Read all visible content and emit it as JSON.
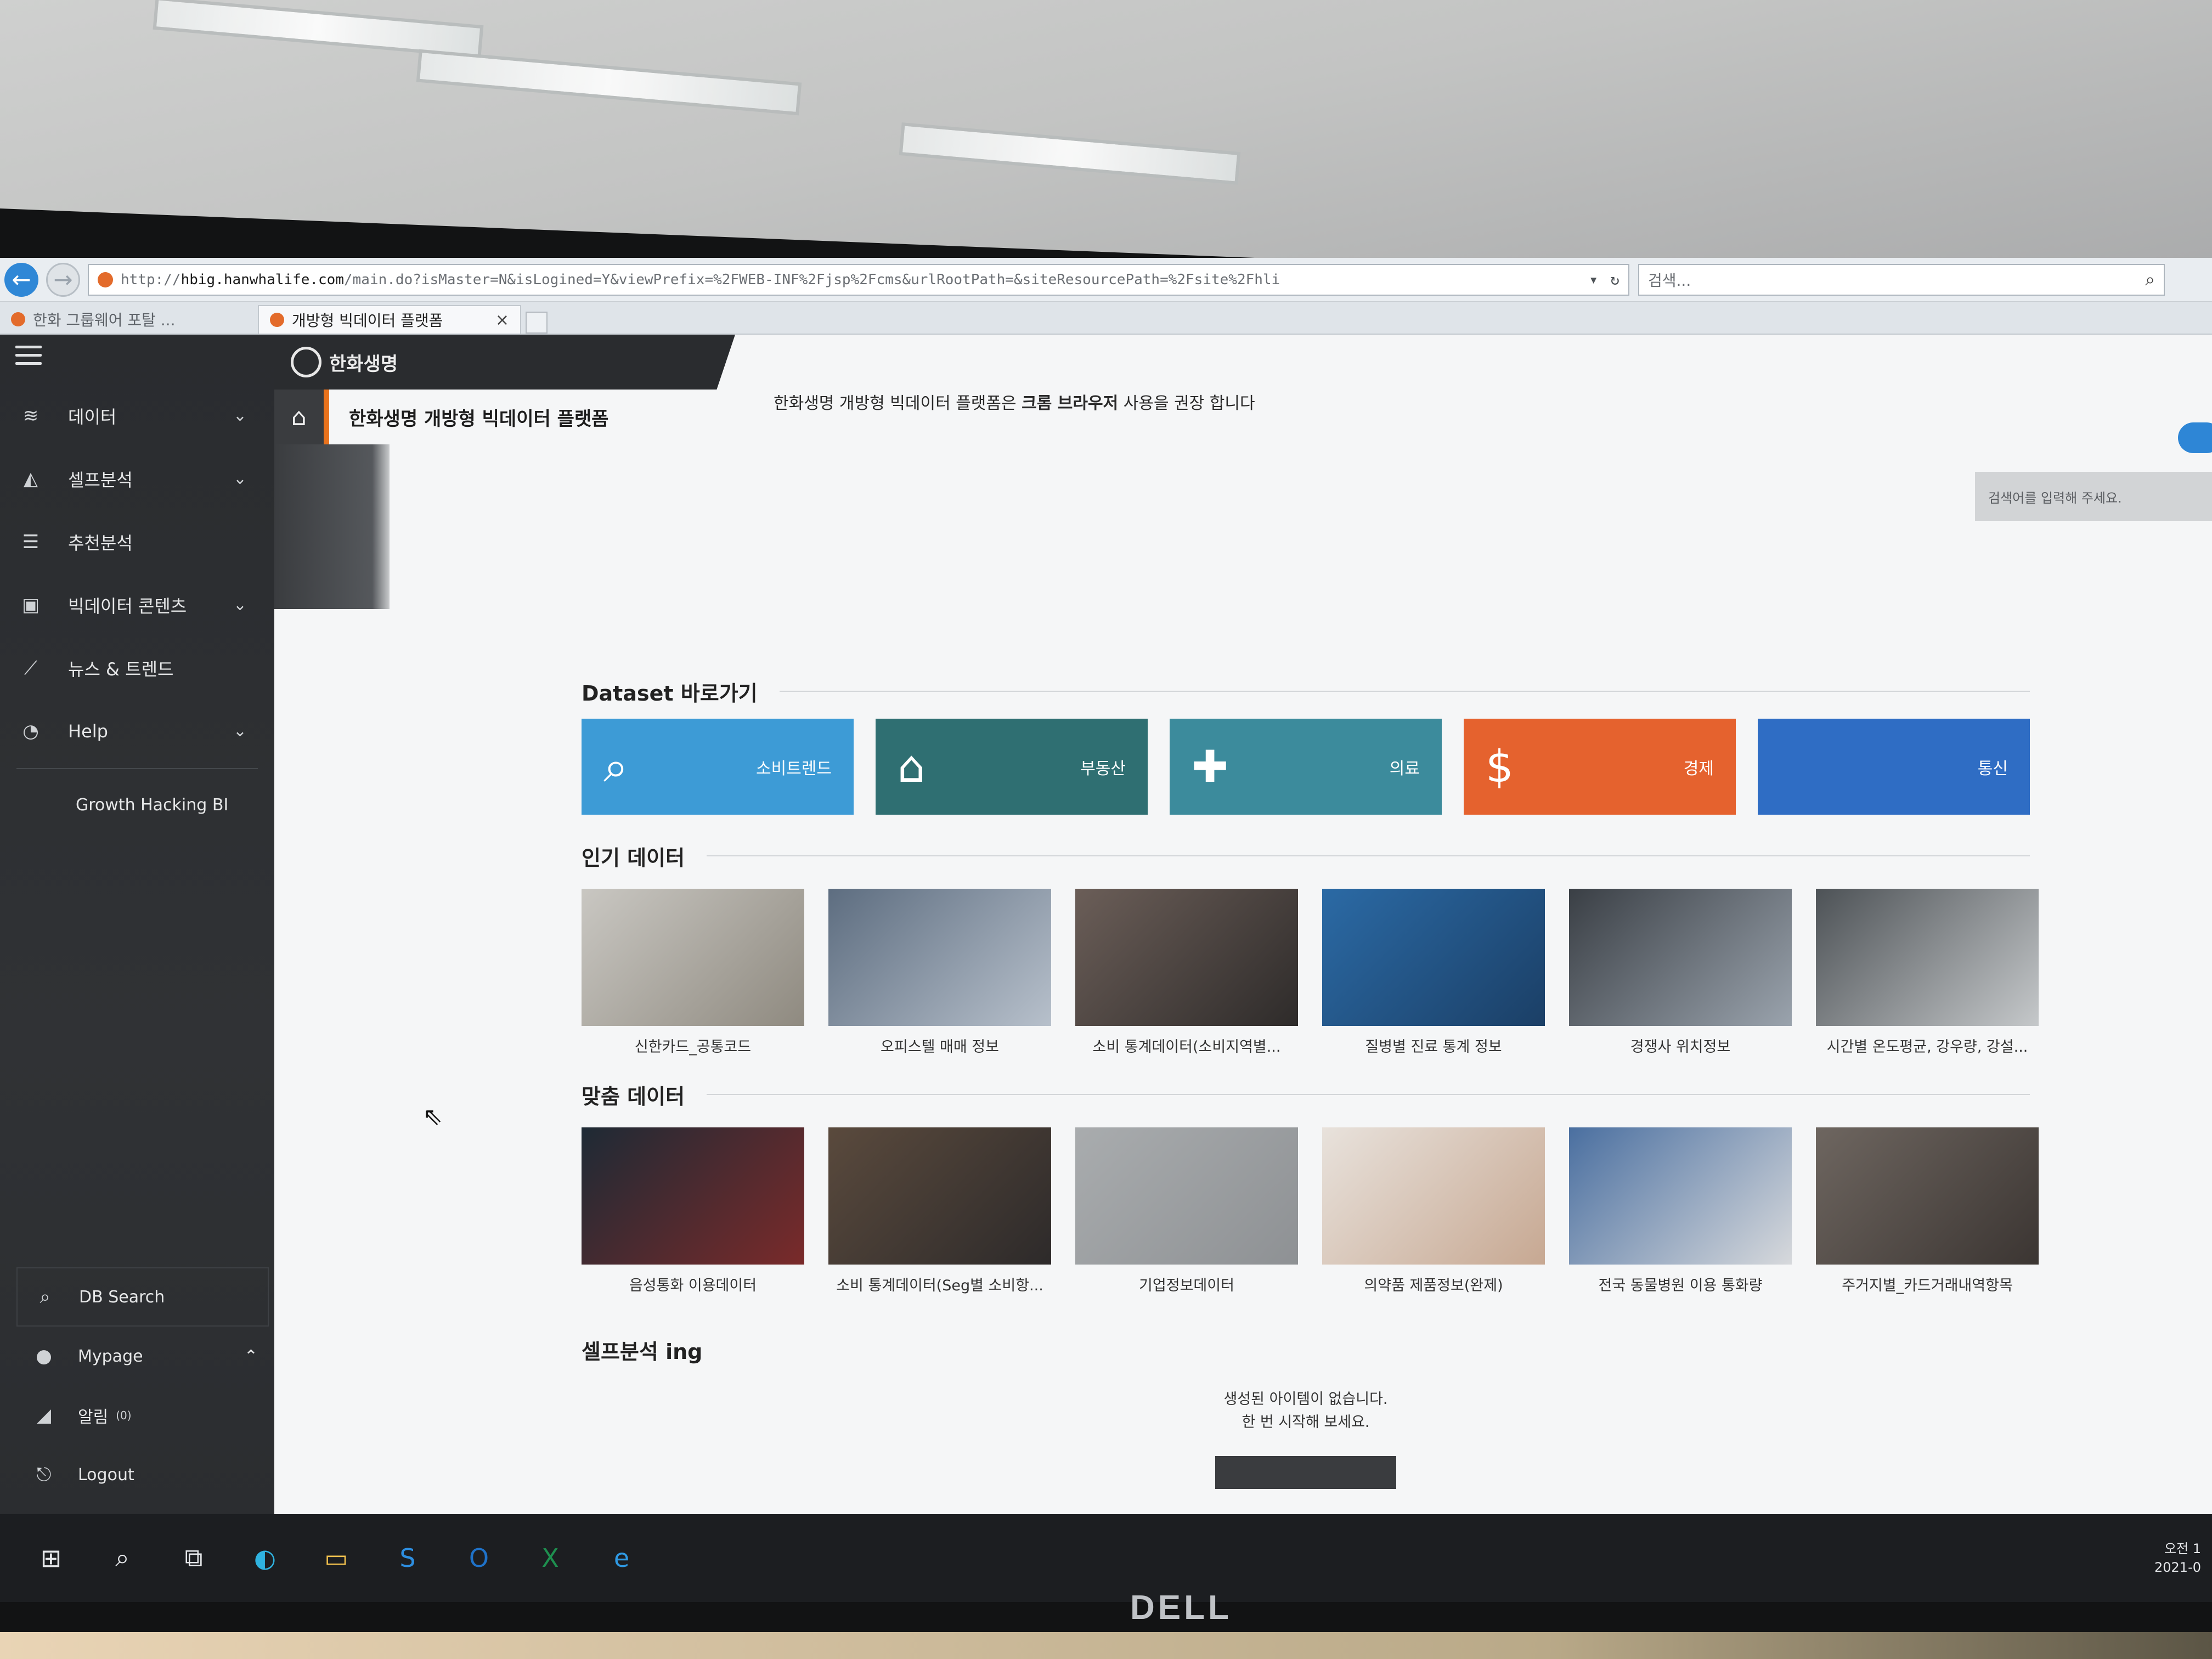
{
  "browser": {
    "url_prefix": "http://",
    "url_domain": "hbig.hanwhalife.com",
    "url_path": "/main.do?isMaster=N&isLogined=Y&viewPrefix=%2FWEB-INF%2Fjsp%2Fcms&urlRootPath=&siteResourcePath=%2Fsite%2Fhli",
    "search_placeholder": "검색...",
    "tabs": [
      {
        "label": "한화 그룹웨어 포탈 ..."
      },
      {
        "label": "개방형 빅데이터 플랫폼"
      }
    ]
  },
  "sidebar": {
    "items": [
      {
        "label": "데이터",
        "icon": "database-icon",
        "glyph": "≋",
        "chevron": "⌄"
      },
      {
        "label": "셀프분석",
        "icon": "area-chart-icon",
        "glyph": "◭",
        "chevron": "⌄"
      },
      {
        "label": "추천분석",
        "icon": "list-icon",
        "glyph": "☰",
        "chevron": ""
      },
      {
        "label": "빅데이터 콘텐츠",
        "icon": "inbox-icon",
        "glyph": "▣",
        "chevron": "⌄"
      },
      {
        "label": "뉴스 & 트렌드",
        "icon": "line-chart-icon",
        "glyph": "⟋",
        "chevron": ""
      },
      {
        "label": "Help",
        "icon": "headset-icon",
        "glyph": "◔",
        "chevron": "⌄"
      }
    ],
    "sub_item": "Growth Hacking BI",
    "bottom": {
      "db_search": "DB Search",
      "mypage": "Mypage",
      "mypage_chevron": "⌃",
      "alarm": "알림",
      "alarm_count": "(0)",
      "logout": "Logout"
    }
  },
  "header": {
    "brand": "한화생명",
    "home_title": "한화생명 개방형 빅데이터 플랫폼",
    "notice_prefix": "한화생명 개방형 빅데이터 플랫폼은 ",
    "notice_bold": "크롬 브라우저",
    "notice_suffix": " 사용을 권장 합니다",
    "search_placeholder": "검색어를 입력해 주세요."
  },
  "dataset": {
    "title": "Dataset 바로가기",
    "cards": [
      {
        "label": "소비트렌드",
        "icon": "search-chart-icon",
        "glyph": "⌕",
        "color": "#3d9bd6"
      },
      {
        "label": "부동산",
        "icon": "house-icon",
        "glyph": "⌂",
        "color": "#2f6f72"
      },
      {
        "label": "의료",
        "icon": "medical-kit-icon",
        "glyph": "✚",
        "color": "#3c8b9c"
      },
      {
        "label": "경제",
        "icon": "coins-icon",
        "glyph": "$",
        "color": "#e5622e"
      },
      {
        "label": "통신",
        "icon": "telecom-icon",
        "glyph": "",
        "color": "#2f6dc4"
      }
    ]
  },
  "popular": {
    "title": "인기 데이터",
    "items": [
      {
        "caption": "신한카드_공통코드",
        "colors": [
          "#c9c7c2",
          "#8f8a80"
        ]
      },
      {
        "caption": "오피스텔 매매 정보",
        "colors": [
          "#5d6d80",
          "#b7c0cb"
        ]
      },
      {
        "caption": "소비 통계데이터(소비지역별...",
        "colors": [
          "#6b5e58",
          "#2e2b2a"
        ]
      },
      {
        "caption": "질병별 진료 통계 정보",
        "colors": [
          "#2b6aa5",
          "#1b3f66"
        ]
      },
      {
        "caption": "경쟁사 위치정보",
        "colors": [
          "#3a3f45",
          "#9aa3ad"
        ]
      },
      {
        "caption": "시간별 온도평균, 강우량, 강설...",
        "colors": [
          "#4d5256",
          "#c5c8ca"
        ]
      }
    ]
  },
  "custom": {
    "title": "맞춤 데이터",
    "items": [
      {
        "caption": "음성통화 이용데이터",
        "colors": [
          "#1e2a35",
          "#7a2a2a"
        ]
      },
      {
        "caption": "소비 통계데이터(Seg별 소비항...",
        "colors": [
          "#5a4a3d",
          "#2d2a2a"
        ]
      },
      {
        "caption": "기업정보데이터",
        "colors": [
          "#a9acae",
          "#8e9194"
        ]
      },
      {
        "caption": "의약품 제품정보(완제)",
        "colors": [
          "#e8e2dc",
          "#c7a892"
        ]
      },
      {
        "caption": "전국 동물병원 이용 통화량",
        "colors": [
          "#4a6fa0",
          "#d7d9dc"
        ]
      },
      {
        "caption": "주거지별_카드거래내역항목",
        "colors": [
          "#6e6660",
          "#3b3532"
        ]
      }
    ]
  },
  "self_analysis": {
    "title": "셀프분석 ing",
    "empty_line1": "생성된 아이템이 없습니다.",
    "empty_line2": "한 번 시작해 보세요."
  },
  "monitor": {
    "brand": "DELL"
  },
  "taskbar": {
    "icons": [
      {
        "name": "windows-start-icon",
        "glyph": "⊞"
      },
      {
        "name": "search-icon",
        "glyph": "⌕"
      },
      {
        "name": "task-view-icon",
        "glyph": "⧉"
      },
      {
        "name": "edge-icon",
        "glyph": "◐"
      },
      {
        "name": "file-explorer-icon",
        "glyph": "▭"
      },
      {
        "name": "skype-icon",
        "glyph": "S"
      },
      {
        "name": "outlook-icon",
        "glyph": "O"
      },
      {
        "name": "excel-icon",
        "glyph": "X"
      },
      {
        "name": "ie-icon",
        "glyph": "e"
      }
    ],
    "clock_line1": "오전 1",
    "clock_line2": "2021-0"
  }
}
